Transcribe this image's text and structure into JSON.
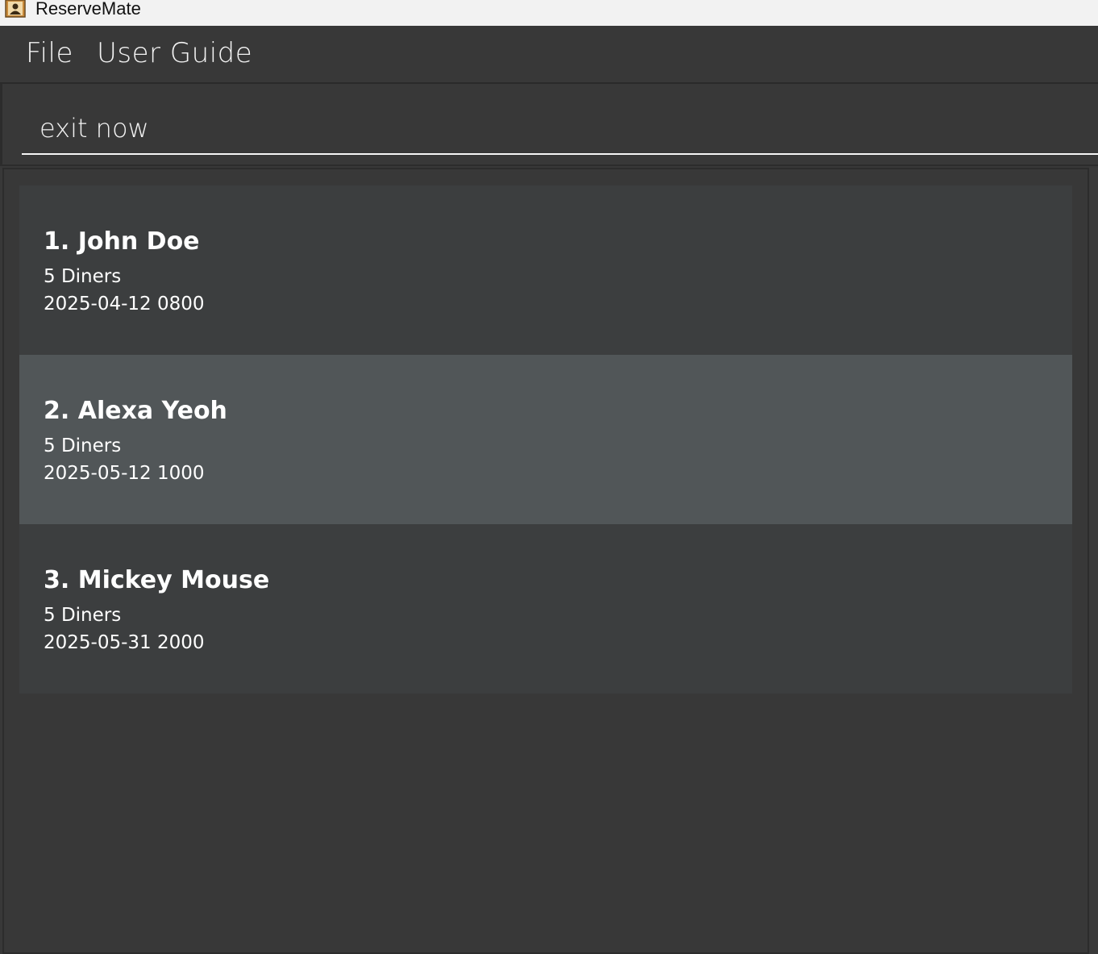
{
  "window": {
    "title": "ReserveMate",
    "icon": "contacts-book-icon"
  },
  "menu": {
    "items": [
      {
        "label": "File"
      },
      {
        "label": "User Guide"
      }
    ]
  },
  "command_box": {
    "value": "exit now"
  },
  "reservations": [
    {
      "index": "1.",
      "name": "John Doe",
      "diners": "5 Diners",
      "datetime": "2025-04-12 0800"
    },
    {
      "index": "2.",
      "name": "Alexa Yeoh",
      "diners": "5 Diners",
      "datetime": "2025-05-12 1000"
    },
    {
      "index": "3.",
      "name": "Mickey Mouse",
      "diners": "5 Diners",
      "datetime": "2025-05-31 2000"
    }
  ],
  "selected_index": 1,
  "colors": {
    "background": "#383838",
    "card_default": "#3c3e3f",
    "card_selected": "#515658",
    "text": "#ffffff",
    "titlebar": "#f2f2f2"
  }
}
